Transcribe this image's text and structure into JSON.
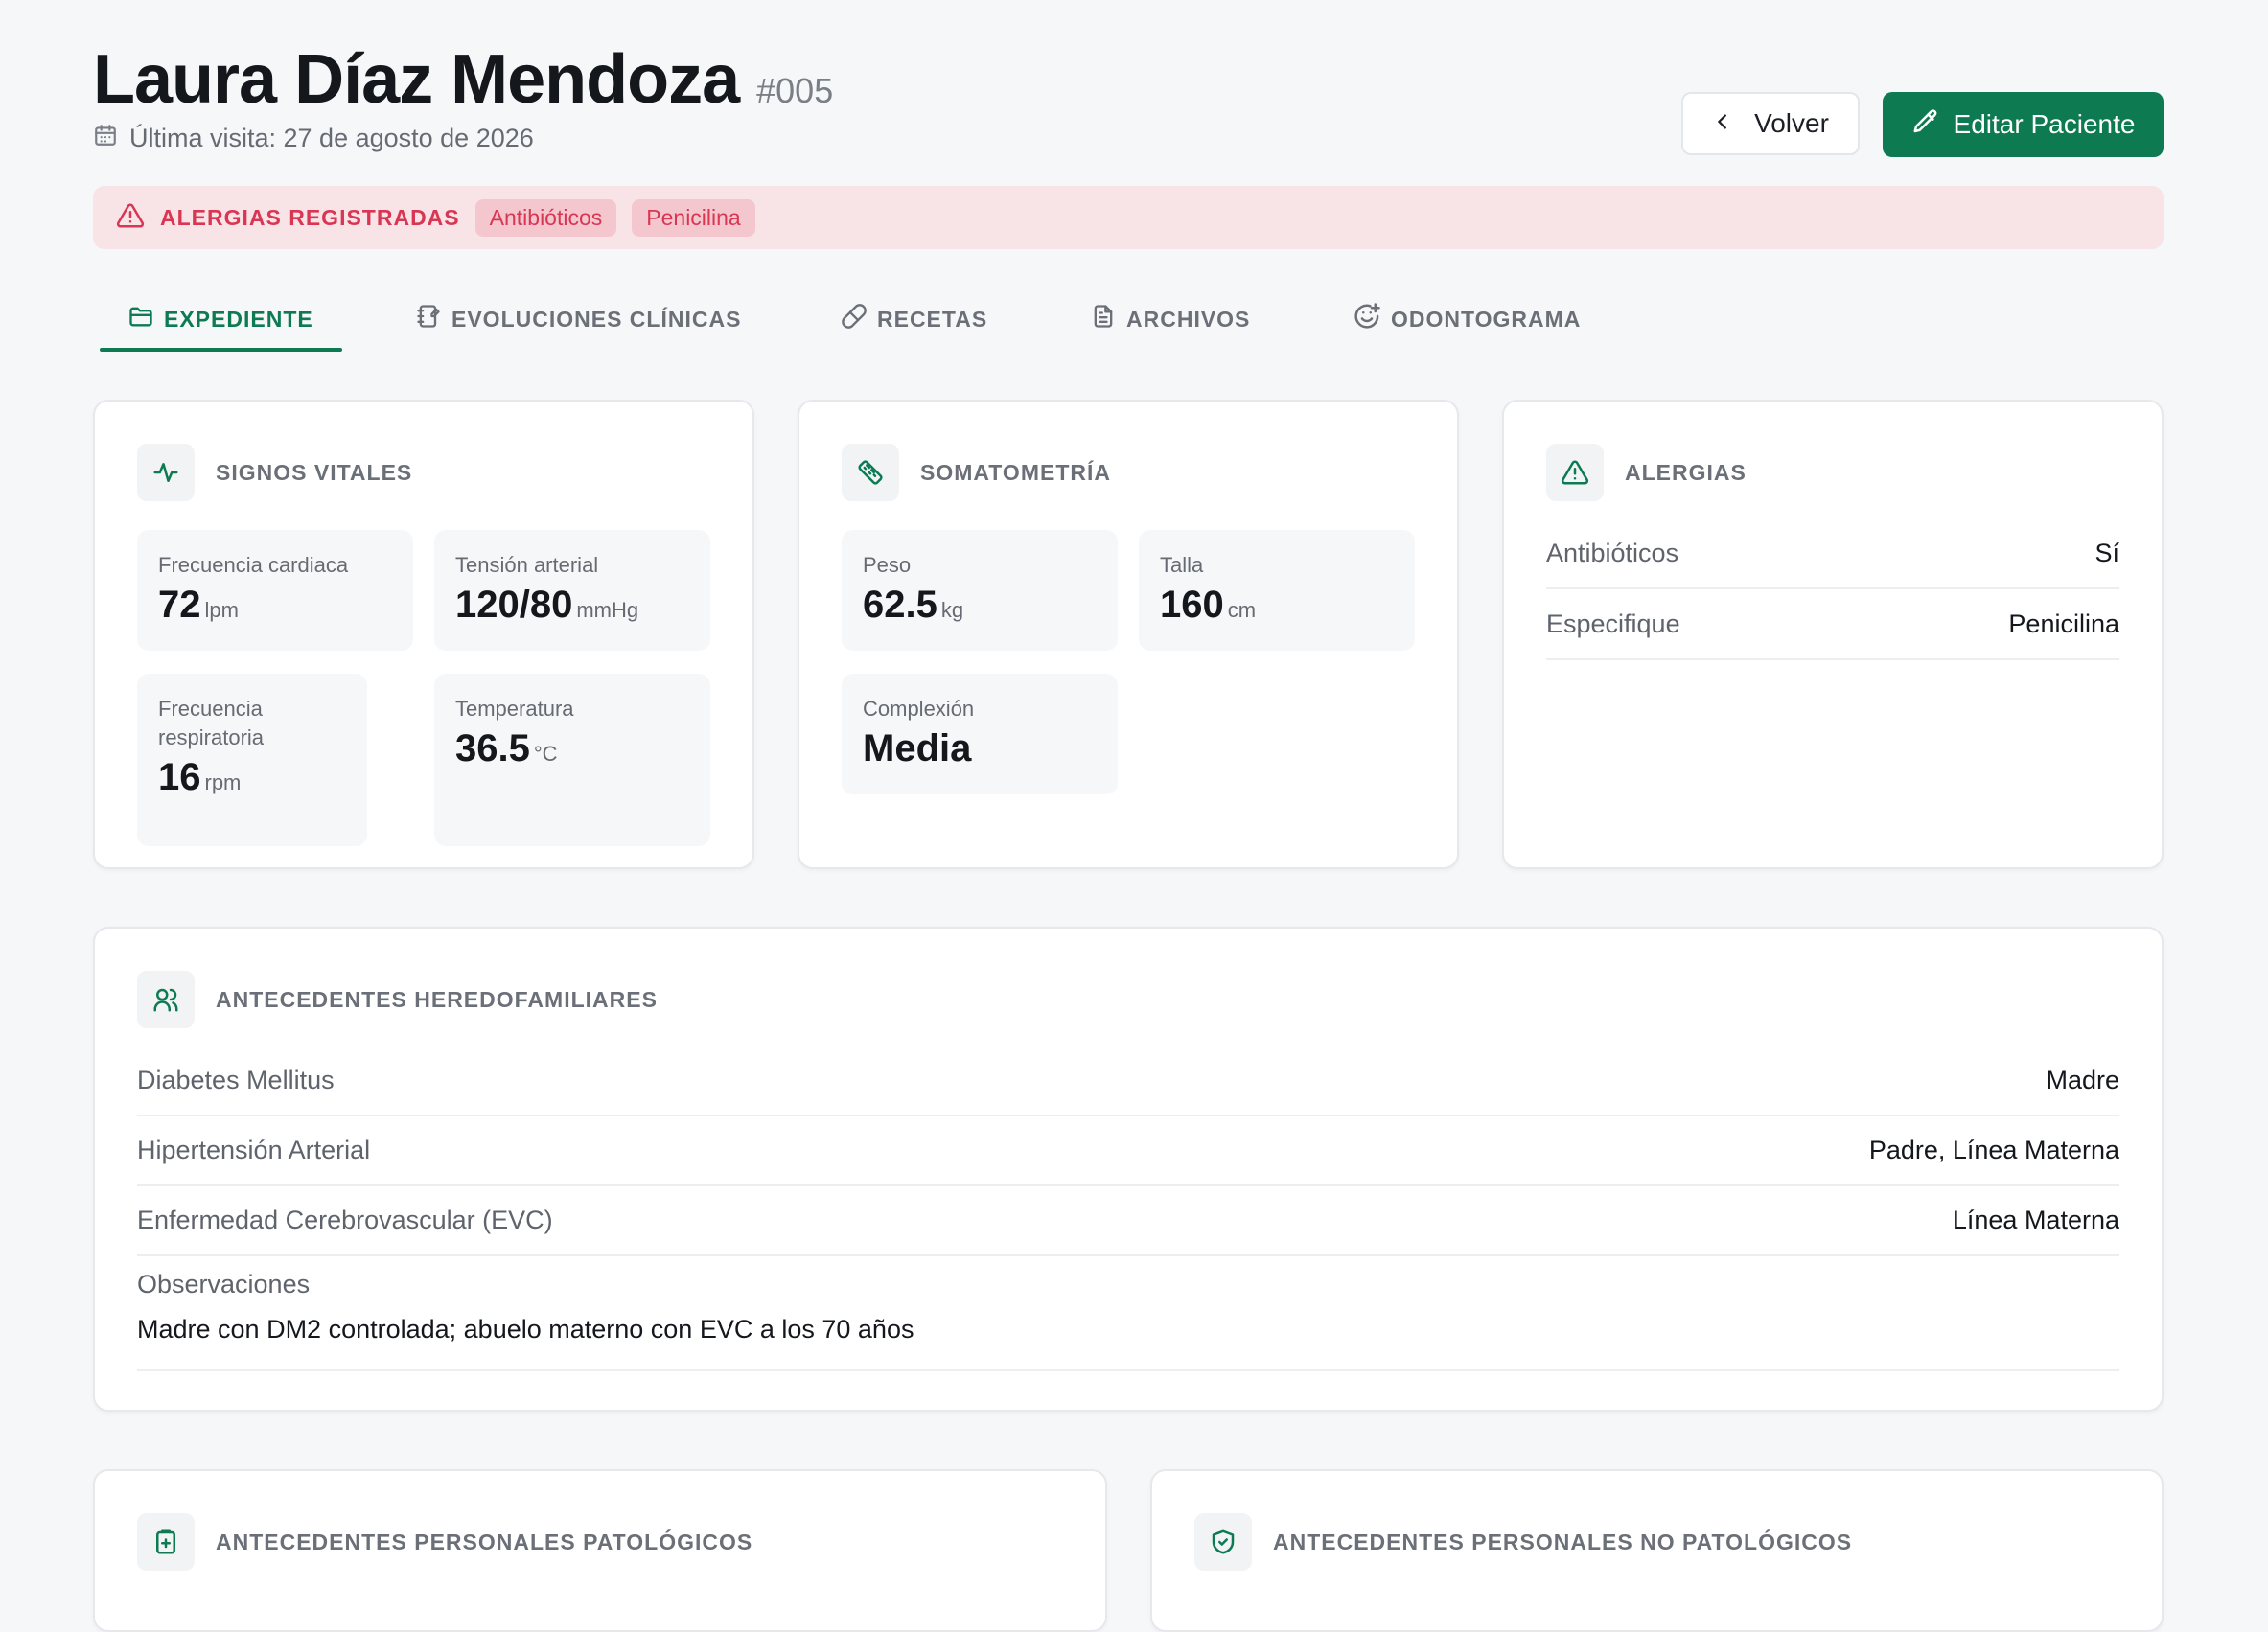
{
  "header": {
    "patient_name": "Laura Díaz Mendoza",
    "patient_id": "#005",
    "last_visit": "Última visita: 27 de agosto de 2026",
    "back_label": "Volver",
    "edit_label": "Editar Paciente"
  },
  "allergy_banner": {
    "title": "ALERGIAS REGISTRADAS",
    "chips": [
      "Antibióticos",
      "Penicilina"
    ]
  },
  "tabs": [
    {
      "label": "EXPEDIENTE",
      "icon": "folder-icon",
      "active": true
    },
    {
      "label": "EVOLUCIONES CLÍNICAS",
      "icon": "notebook-edit-icon",
      "active": false
    },
    {
      "label": "RECETAS",
      "icon": "pill-icon",
      "active": false
    },
    {
      "label": "ARCHIVOS",
      "icon": "document-icon",
      "active": false
    },
    {
      "label": "ODONTOGRAMA",
      "icon": "tooth-smile-icon",
      "active": false
    }
  ],
  "vital_signs": {
    "title": "SIGNOS VITALES",
    "items": [
      {
        "label": "Frecuencia cardiaca",
        "value": "72",
        "unit": "lpm"
      },
      {
        "label": "Tensión arterial",
        "value": "120/80",
        "unit": "mmHg"
      },
      {
        "label": "Frecuencia respiratoria",
        "value": "16",
        "unit": "rpm"
      },
      {
        "label": "Temperatura",
        "value": "36.5",
        "unit": "°C"
      }
    ]
  },
  "somatometry": {
    "title": "SOMATOMETRÍA",
    "items": [
      {
        "label": "Peso",
        "value": "62.5",
        "unit": "kg"
      },
      {
        "label": "Talla",
        "value": "160",
        "unit": "cm"
      },
      {
        "label": "Complexión",
        "value": "Media",
        "unit": ""
      }
    ]
  },
  "allergies": {
    "title": "ALERGIAS",
    "rows": [
      {
        "key": "Antibióticos",
        "value": "Sí"
      },
      {
        "key": "Especifique",
        "value": "Penicilina"
      }
    ]
  },
  "family_history": {
    "title": "ANTECEDENTES HEREDOFAMILIARES",
    "rows": [
      {
        "key": "Diabetes Mellitus",
        "value": "Madre"
      },
      {
        "key": "Hipertensión Arterial",
        "value": "Padre, Línea Materna"
      },
      {
        "key": "Enfermedad Cerebrovascular (EVC)",
        "value": "Línea Materna"
      }
    ],
    "observations_label": "Observaciones",
    "observations_text": "Madre con DM2 controlada; abuelo materno con EVC a los 70 años"
  },
  "pathological_history": {
    "title": "ANTECEDENTES PERSONALES PATOLÓGICOS"
  },
  "non_pathological_history": {
    "title": "ANTECEDENTES PERSONALES NO PATOLÓGICOS"
  },
  "colors": {
    "primary": "#0d7a52",
    "danger": "#d93654",
    "danger_bg": "#f8e4e7"
  }
}
